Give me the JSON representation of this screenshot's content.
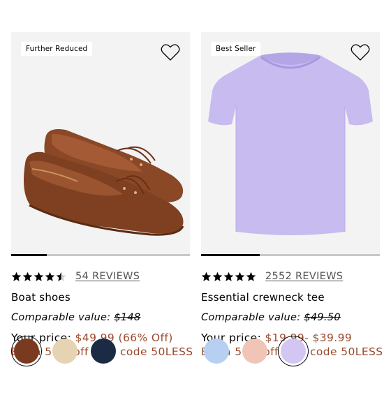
{
  "products": [
    {
      "badge": "Further Reduced",
      "stars": "4.5 of 5",
      "reviews": "54 REVIEWS",
      "name": "Boat shoes",
      "comparable_label": "Comparable value:",
      "comparable_price": "$148",
      "your_price_label": "Your price:",
      "price": "$49.99 (66% Off)",
      "promo": "Extra 50% off with code 50LESS",
      "image_progress": 0.2,
      "swatches": [
        "#7a3a1f",
        "#e6d3b3",
        "#1c2b44"
      ],
      "selected_swatch": 0
    },
    {
      "badge": "Best Seller",
      "stars": "5 of 5",
      "reviews": "2552 REVIEWS",
      "name": "Essential crewneck tee",
      "comparable_label": "Comparable value:",
      "comparable_price": "$49.50",
      "your_price_label": "Your price:",
      "price": "$19.99- $39.99",
      "promo": "Extra 50% off with code 50LESS",
      "image_progress": 0.33,
      "swatches": [
        "#b7d0f2",
        "#f0c5b8",
        "#d3c6f2"
      ],
      "selected_swatch": 2
    }
  ],
  "icons": {
    "heart": "heart-icon",
    "star": "star-icon"
  }
}
